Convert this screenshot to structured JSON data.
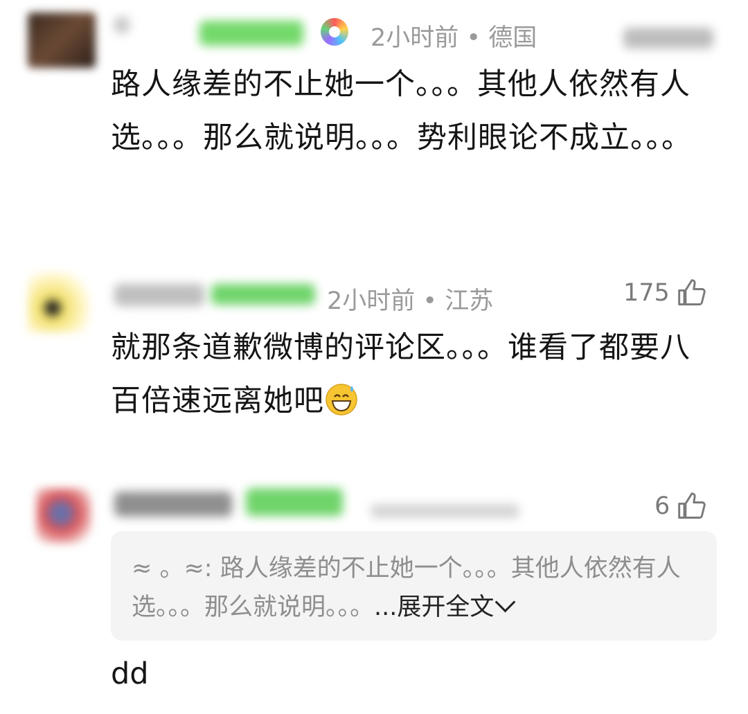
{
  "comments": [
    {
      "time": "2小时前",
      "location": "德国",
      "text": "路人缘差的不止她一个。。。其他人依然有人选。。。那么就说明。。。势利眼论不成立。。。"
    },
    {
      "time": "2小时前",
      "location": "江苏",
      "likes": "175",
      "text": "就那条道歉微博的评论区。。。谁看了都要八百倍速远离她吧"
    },
    {
      "likes": "6",
      "quote": {
        "prefix": "≈ 。≈:",
        "text": "路人缘差的不止她一个。。。其他人依然有人选。。。那么就说明。。。",
        "expand": "...展开全文"
      },
      "text": "dd"
    }
  ],
  "icons": {
    "like": "thumbs-up-icon",
    "emoji": "grinning-sweat-emoji-icon",
    "badge": "colorful-badge-icon"
  },
  "colors": {
    "meta": "#9a9a9a",
    "quote_bg": "#f4f4f4",
    "verified_green": "#4cd964"
  }
}
